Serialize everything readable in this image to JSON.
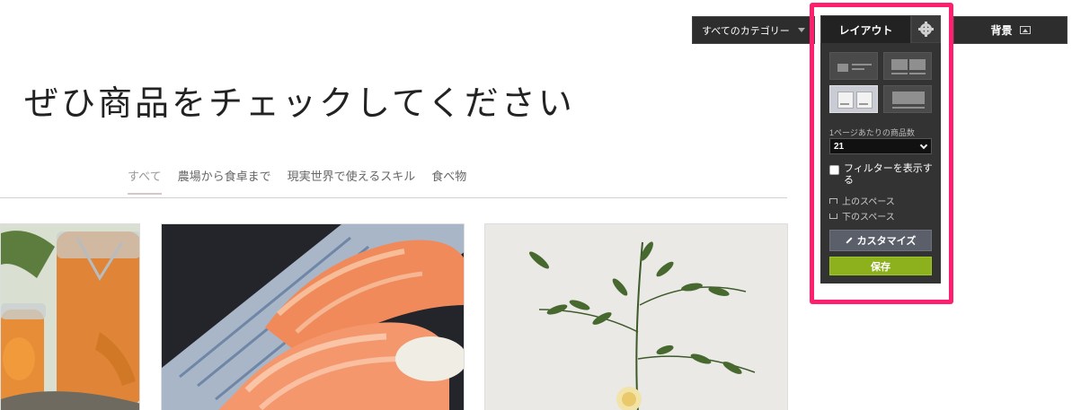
{
  "heading": "ぜひ商品をチェックしてください",
  "tabs": [
    {
      "label": "すべて",
      "active": true
    },
    {
      "label": "農場から食卓まで",
      "active": false
    },
    {
      "label": "現実世界で使えるスキル",
      "active": false
    },
    {
      "label": "食べ物",
      "active": false
    }
  ],
  "toolbar": {
    "category_select": "すべてのカテゴリー",
    "background_button": "背景"
  },
  "panel": {
    "tab_layout": "レイアウト",
    "layout_options": [
      "list",
      "grid-two-column",
      "grid-cards",
      "large-image"
    ],
    "selected_layout": "grid-cards",
    "per_page_label": "1ページあたりの商品数",
    "per_page_value": "21",
    "filter_label": "フィルターを表示する",
    "filter_checked": false,
    "space_top": "上のスペース",
    "space_bottom": "下のスペース",
    "customize_button": "カスタマイズ",
    "save_button": "保存"
  },
  "colors": {
    "highlight": "#ff1f6e",
    "panel_bg": "#333333",
    "save_green": "#8cb11c",
    "customize_gray": "#5a5f6a"
  },
  "icons": [
    "chevron-down-icon",
    "gear-icon",
    "image-icon",
    "pencil-icon"
  ]
}
